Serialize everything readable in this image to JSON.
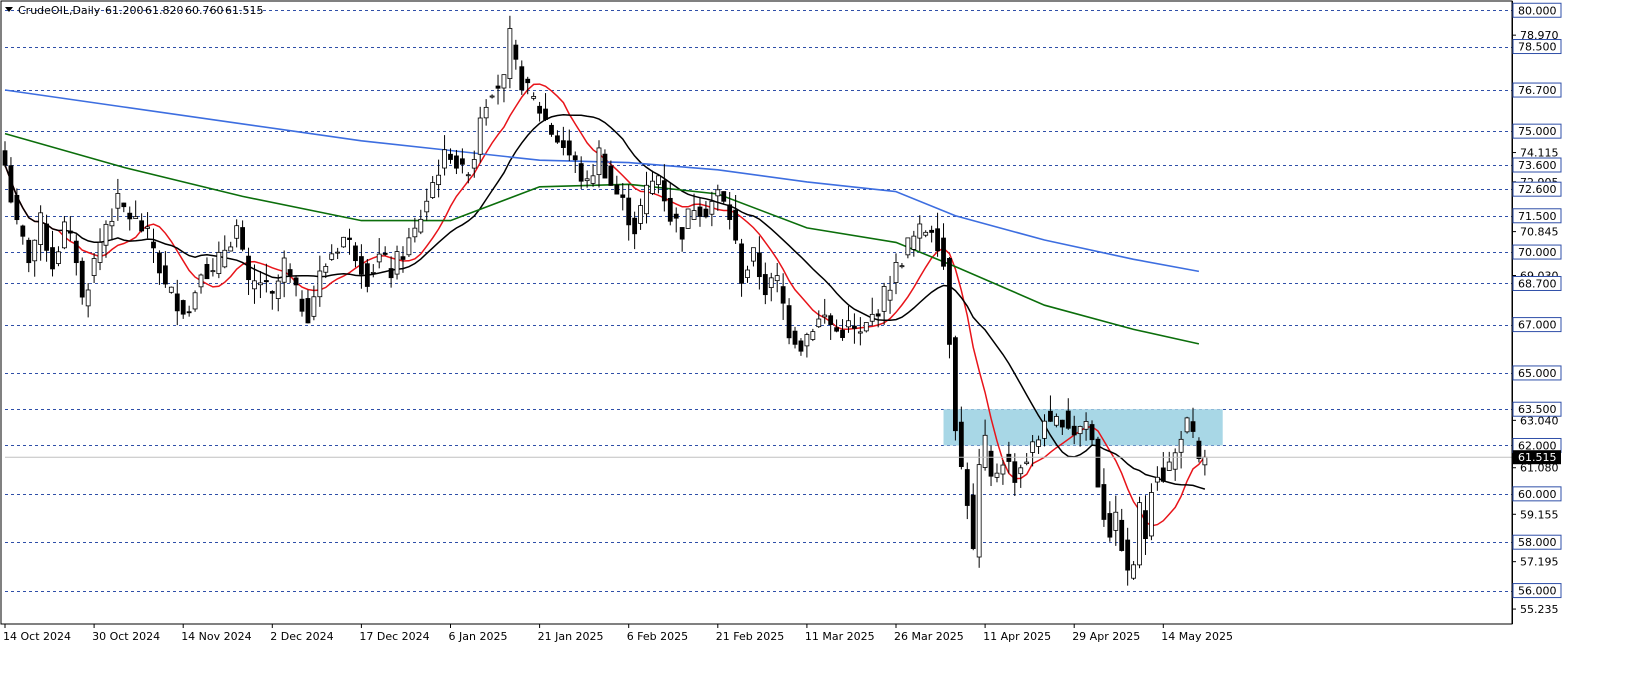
{
  "header": {
    "symbol": "CrudeOIL,Daily",
    "open": "61.200",
    "high": "61.820",
    "low": "60.760",
    "close": "61.515"
  },
  "colors": {
    "grid": "#2f4fa8",
    "ma_fast": "#e8141a",
    "ma_mid": "#000000",
    "ma_slow": "#0b6e0b",
    "ma_long": "#3d6ee0",
    "zone": "#a8d7e6",
    "bull_fill": "#ffffff",
    "bear_fill": "#000000"
  },
  "chart_data": {
    "type": "candlestick",
    "ylim": [
      54.7,
      80.3
    ],
    "x_count": 210,
    "levels": [
      "80.000",
      "78.500",
      "76.700",
      "75.000",
      "73.600",
      "72.600",
      "71.500",
      "70.000",
      "68.700",
      "67.000",
      "65.000",
      "63.500",
      "62.000",
      "60.000",
      "58.000",
      "56.000"
    ],
    "minor_ticks": [
      "78.970",
      "74.115",
      "72.905",
      "70.845",
      "69.030",
      "63.040",
      "61.080",
      "59.155",
      "57.195",
      "55.235"
    ],
    "current_price": "61.515",
    "zone": {
      "from_index": 158,
      "to_index": 205,
      "low": 62.0,
      "high": 63.5
    },
    "date_labels": [
      {
        "index": 0,
        "label": "14 Oct 2024"
      },
      {
        "index": 15,
        "label": "30 Oct 2024"
      },
      {
        "index": 30,
        "label": "14 Nov 2024"
      },
      {
        "index": 45,
        "label": "2 Dec 2024"
      },
      {
        "index": 60,
        "label": "17 Dec 2024"
      },
      {
        "index": 75,
        "label": "6 Jan 2025"
      },
      {
        "index": 90,
        "label": "21 Jan 2025"
      },
      {
        "index": 105,
        "label": "6 Feb 2025"
      },
      {
        "index": 120,
        "label": "21 Feb 2025"
      },
      {
        "index": 135,
        "label": "11 Mar 2025"
      },
      {
        "index": 150,
        "label": "26 Mar 2025"
      },
      {
        "index": 165,
        "label": "11 Apr 2025"
      },
      {
        "index": 180,
        "label": "29 Apr 2025"
      },
      {
        "index": 195,
        "label": "14 May 2025"
      }
    ],
    "close_anchors": [
      [
        0,
        73.6
      ],
      [
        2,
        71.0
      ],
      [
        4,
        69.8
      ],
      [
        6,
        71.2
      ],
      [
        8,
        69.5
      ],
      [
        10,
        71.0
      ],
      [
        12,
        69.8
      ],
      [
        13,
        68.0
      ],
      [
        15,
        69.6
      ],
      [
        17,
        71.2
      ],
      [
        19,
        72.0
      ],
      [
        21,
        71.5
      ],
      [
        23,
        71.0
      ],
      [
        25,
        70.2
      ],
      [
        27,
        68.5
      ],
      [
        29,
        68.0
      ],
      [
        31,
        67.5
      ],
      [
        33,
        69.5
      ],
      [
        35,
        69.0
      ],
      [
        37,
        70.2
      ],
      [
        39,
        71.0
      ],
      [
        41,
        68.5
      ],
      [
        43,
        68.8
      ],
      [
        45,
        68.0
      ],
      [
        47,
        69.5
      ],
      [
        49,
        68.2
      ],
      [
        51,
        67.5
      ],
      [
        53,
        69.0
      ],
      [
        55,
        70.0
      ],
      [
        57,
        70.6
      ],
      [
        59,
        70.0
      ],
      [
        61,
        69.0
      ],
      [
        63,
        69.8
      ],
      [
        65,
        69.2
      ],
      [
        67,
        70.0
      ],
      [
        69,
        70.8
      ],
      [
        71,
        72.2
      ],
      [
        73,
        73.5
      ],
      [
        75,
        74.2
      ],
      [
        77,
        73.2
      ],
      [
        79,
        74.0
      ],
      [
        80,
        75.8
      ],
      [
        82,
        76.9
      ],
      [
        84,
        77.0
      ],
      [
        85,
        78.8
      ],
      [
        86,
        77.6
      ],
      [
        88,
        76.6
      ],
      [
        90,
        75.9
      ],
      [
        92,
        75.0
      ],
      [
        94,
        74.4
      ],
      [
        96,
        73.6
      ],
      [
        98,
        72.7
      ],
      [
        100,
        74.1
      ],
      [
        102,
        72.8
      ],
      [
        104,
        72.0
      ],
      [
        106,
        71.0
      ],
      [
        108,
        72.5
      ],
      [
        110,
        73.2
      ],
      [
        112,
        71.5
      ],
      [
        114,
        70.9
      ],
      [
        116,
        72.0
      ],
      [
        118,
        71.8
      ],
      [
        120,
        72.4
      ],
      [
        122,
        71.5
      ],
      [
        124,
        69.0
      ],
      [
        126,
        69.8
      ],
      [
        128,
        68.5
      ],
      [
        130,
        68.8
      ],
      [
        132,
        66.8
      ],
      [
        134,
        66.2
      ],
      [
        136,
        67.0
      ],
      [
        138,
        67.3
      ],
      [
        140,
        66.7
      ],
      [
        142,
        66.9
      ],
      [
        144,
        66.5
      ],
      [
        146,
        67.3
      ],
      [
        148,
        68.2
      ],
      [
        150,
        69.3
      ],
      [
        152,
        70.3
      ],
      [
        154,
        70.8
      ],
      [
        156,
        71.1
      ],
      [
        157,
        70.5
      ],
      [
        158,
        69.5
      ],
      [
        159,
        66.5
      ],
      [
        160,
        63.0
      ],
      [
        161,
        61.0
      ],
      [
        162,
        59.8
      ],
      [
        163,
        57.5
      ],
      [
        164,
        61.0
      ],
      [
        165,
        62.0
      ],
      [
        166,
        60.5
      ],
      [
        168,
        61.5
      ],
      [
        170,
        60.8
      ],
      [
        172,
        61.5
      ],
      [
        174,
        62.3
      ],
      [
        175,
        63.3
      ],
      [
        176,
        62.6
      ],
      [
        178,
        63.2
      ],
      [
        180,
        62.6
      ],
      [
        182,
        63.0
      ],
      [
        183,
        62.2
      ],
      [
        184,
        60.5
      ],
      [
        185,
        59.2
      ],
      [
        186,
        58.5
      ],
      [
        187,
        58.8
      ],
      [
        188,
        58.0
      ],
      [
        189,
        56.5
      ],
      [
        190,
        57.2
      ],
      [
        191,
        59.3
      ],
      [
        192,
        58.3
      ],
      [
        193,
        60.5
      ],
      [
        194,
        61.0
      ],
      [
        195,
        60.8
      ],
      [
        196,
        61.2
      ],
      [
        197,
        61.6
      ],
      [
        198,
        62.6
      ],
      [
        199,
        62.8
      ],
      [
        200,
        62.2
      ],
      [
        201,
        61.2
      ],
      [
        202,
        61.515
      ]
    ],
    "series": [
      {
        "name": "",
        "color_key": "ma_fast",
        "period": 10,
        "values": []
      },
      {
        "name": "",
        "color_key": "ma_mid",
        "period": 20,
        "values": []
      },
      {
        "name": "",
        "color_key": "ma_slow",
        "points": [
          [
            0,
            74.9
          ],
          [
            20,
            73.5
          ],
          [
            40,
            72.3
          ],
          [
            60,
            71.3
          ],
          [
            75,
            71.3
          ],
          [
            90,
            72.7
          ],
          [
            105,
            72.8
          ],
          [
            120,
            72.4
          ],
          [
            135,
            71.0
          ],
          [
            150,
            70.4
          ],
          [
            160,
            69.4
          ],
          [
            175,
            67.8
          ],
          [
            190,
            66.8
          ],
          [
            201,
            66.2
          ]
        ]
      },
      {
        "name": "",
        "color_key": "ma_long",
        "points": [
          [
            0,
            76.7
          ],
          [
            20,
            76.0
          ],
          [
            40,
            75.3
          ],
          [
            60,
            74.6
          ],
          [
            75,
            74.2
          ],
          [
            90,
            73.8
          ],
          [
            105,
            73.7
          ],
          [
            120,
            73.4
          ],
          [
            135,
            72.9
          ],
          [
            150,
            72.5
          ],
          [
            160,
            71.5
          ],
          [
            175,
            70.5
          ],
          [
            190,
            69.7
          ],
          [
            201,
            69.2
          ]
        ]
      }
    ]
  }
}
